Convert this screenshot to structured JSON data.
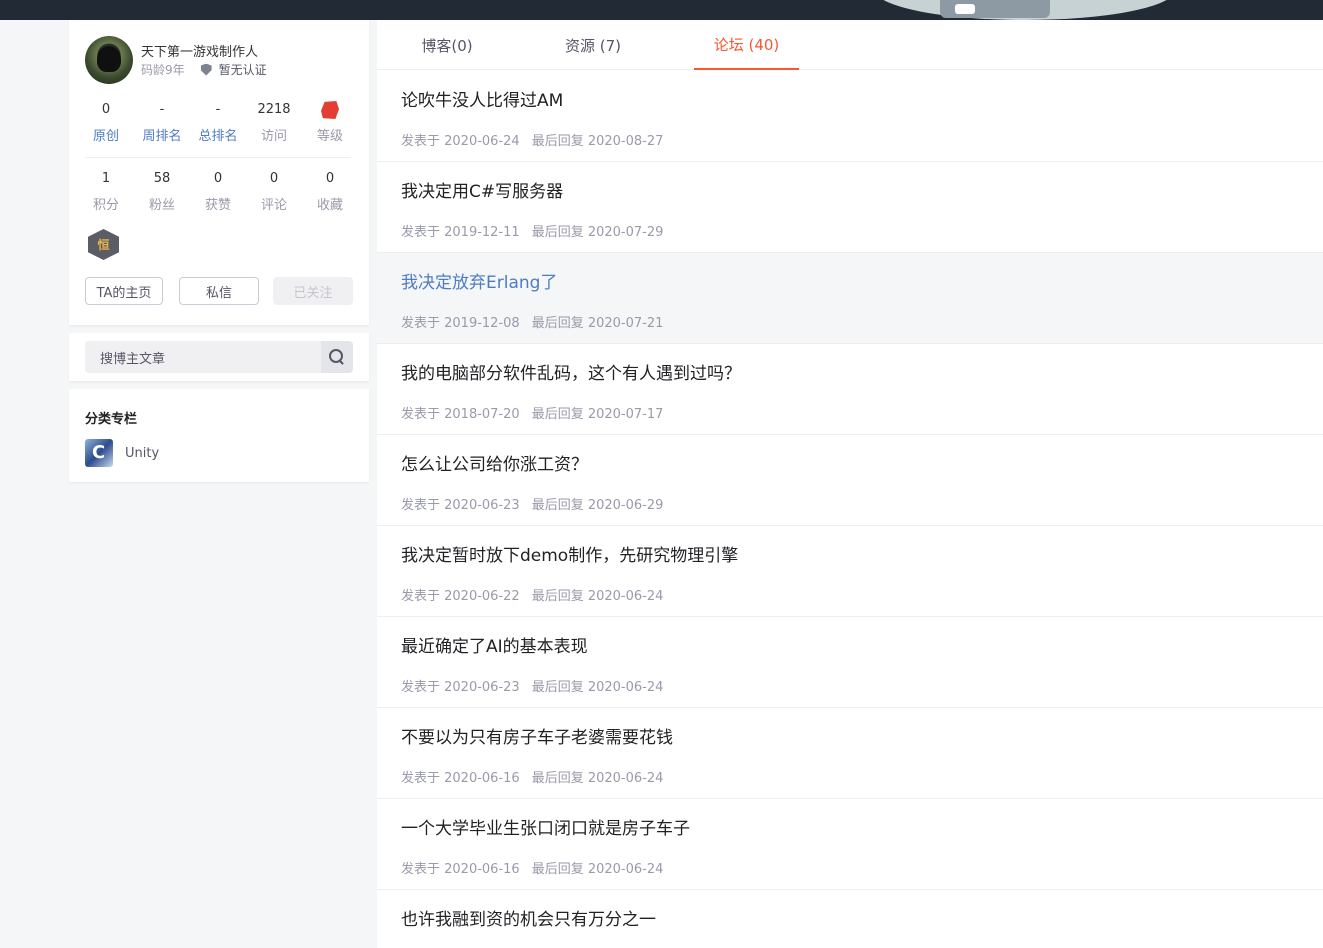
{
  "profile": {
    "username": "天下第一游戏制作人",
    "code_age": "码龄9年",
    "certification": "暂无认证",
    "stats_row1": [
      {
        "num": "0",
        "label": "原创"
      },
      {
        "num": "-",
        "label": "周排名"
      },
      {
        "num": "-",
        "label": "总排名"
      },
      {
        "num": "2218",
        "label": "访问"
      },
      {
        "num": "",
        "label": "等级"
      }
    ],
    "stats_row2": [
      {
        "num": "1",
        "label": "积分"
      },
      {
        "num": "58",
        "label": "粉丝"
      },
      {
        "num": "0",
        "label": "获赞"
      },
      {
        "num": "0",
        "label": "评论"
      },
      {
        "num": "0",
        "label": "收藏"
      }
    ],
    "badge_char": "恒",
    "buttons": {
      "home": "TA的主页",
      "message": "私信",
      "follow": "已关注"
    }
  },
  "search": {
    "placeholder": "搜博主文章"
  },
  "category": {
    "title": "分类专栏",
    "items": [
      {
        "name": "Unity"
      }
    ]
  },
  "tabs": [
    {
      "label": "博客(0)"
    },
    {
      "label": "资源 (7)"
    },
    {
      "label": "论坛 (40)"
    }
  ],
  "posts": [
    {
      "title": "论吹牛没人比得过AM",
      "posted": "发表于 2020-06-24",
      "reply": "最后回复 2020-08-27"
    },
    {
      "title": "我决定用C#写服务器",
      "posted": "发表于 2019-12-11",
      "reply": "最后回复 2020-07-29"
    },
    {
      "title": "我决定放弃Erlang了",
      "posted": "发表于 2019-12-08",
      "reply": "最后回复 2020-07-21"
    },
    {
      "title": "我的电脑部分软件乱码，这个有人遇到过吗？",
      "posted": "发表于 2018-07-20",
      "reply": "最后回复 2020-07-17"
    },
    {
      "title": "怎么让公司给你涨工资？",
      "posted": "发表于 2020-06-23",
      "reply": "最后回复 2020-06-29"
    },
    {
      "title": "我决定暂时放下demo制作，先研究物理引擎",
      "posted": "发表于 2020-06-22",
      "reply": "最后回复 2020-06-24"
    },
    {
      "title": "最近确定了AI的基本表现",
      "posted": "发表于 2020-06-23",
      "reply": "最后回复 2020-06-24"
    },
    {
      "title": "不要以为只有房子车子老婆需要花钱",
      "posted": "发表于 2020-06-16",
      "reply": "最后回复 2020-06-24"
    },
    {
      "title": "一个大学毕业生张口闭口就是房子车子",
      "posted": "发表于 2020-06-16",
      "reply": "最后回复 2020-06-24"
    },
    {
      "title": "也许我融到资的机会只有万分之一",
      "posted": "",
      "reply": ""
    }
  ],
  "colors": {
    "accent": "#fc5531",
    "link": "#4d7cc4",
    "topbar": "#222b35"
  }
}
